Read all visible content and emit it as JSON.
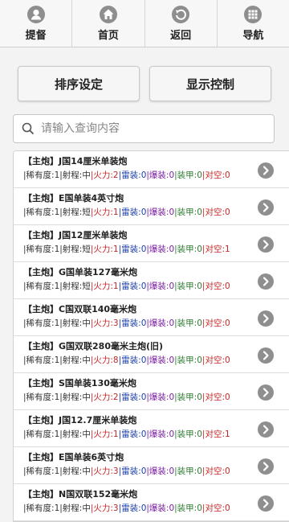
{
  "nav": [
    {
      "label": "提督",
      "icon": "user-icon"
    },
    {
      "label": "首页",
      "icon": "home-icon"
    },
    {
      "label": "返回",
      "icon": "back-icon"
    },
    {
      "label": "导航",
      "icon": "grid-icon"
    }
  ],
  "buttons": {
    "sort": "排序设定",
    "display": "显示控制"
  },
  "search": {
    "placeholder": "请输入查询内容",
    "value": ""
  },
  "stat_labels": {
    "rarity": "|稀有度:",
    "range": "|射程:",
    "firepower": "|火力:",
    "torpedo": "|雷装:",
    "bomb": "|爆装:",
    "armor": "|装甲:",
    "aa": "|对空:"
  },
  "items": [
    {
      "title": "【主炮】J国14厘米单装炮",
      "rarity": "1",
      "range": "中",
      "firepower": "2",
      "torpedo": "0",
      "bomb": "0",
      "armor": "0",
      "aa": "0"
    },
    {
      "title": "【主炮】E国单装4英寸炮",
      "rarity": "1",
      "range": "短",
      "firepower": "1",
      "torpedo": "0",
      "bomb": "0",
      "armor": "0",
      "aa": "0"
    },
    {
      "title": "【主炮】J国12厘米单装炮",
      "rarity": "1",
      "range": "短",
      "firepower": "1",
      "torpedo": "0",
      "bomb": "0",
      "armor": "0",
      "aa": "1"
    },
    {
      "title": "【主炮】G国单装127毫米炮",
      "rarity": "1",
      "range": "短",
      "firepower": "1",
      "torpedo": "0",
      "bomb": "0",
      "armor": "0",
      "aa": "0"
    },
    {
      "title": "【主炮】C国双联140毫米炮",
      "rarity": "1",
      "range": "中",
      "firepower": "3",
      "torpedo": "0",
      "bomb": "0",
      "armor": "0",
      "aa": "0"
    },
    {
      "title": "【主炮】G国双联280毫米主炮(旧)",
      "rarity": "1",
      "range": "中",
      "firepower": "8",
      "torpedo": "0",
      "bomb": "0",
      "armor": "0",
      "aa": "0"
    },
    {
      "title": "【主炮】S国单装130毫米炮",
      "rarity": "1",
      "range": "中",
      "firepower": "2",
      "torpedo": "0",
      "bomb": "0",
      "armor": "0",
      "aa": "0"
    },
    {
      "title": "【主炮】J国12.7厘米单装炮",
      "rarity": "1",
      "range": "中",
      "firepower": "1",
      "torpedo": "0",
      "bomb": "0",
      "armor": "0",
      "aa": "1"
    },
    {
      "title": "【主炮】E国单装6英寸炮",
      "rarity": "1",
      "range": "中",
      "firepower": "3",
      "torpedo": "0",
      "bomb": "0",
      "armor": "0",
      "aa": "0"
    },
    {
      "title": "【主炮】N国双联152毫米炮",
      "rarity": "1",
      "range": "中",
      "firepower": "3",
      "torpedo": "0",
      "bomb": "0",
      "armor": "0",
      "aa": "0"
    }
  ],
  "colors": {
    "firepower": "#c62828",
    "torpedo": "#1b3fa8",
    "bomb": "#7b1fa2",
    "armor": "#2e7d32",
    "aa": "#c62828",
    "icon_gray": "#8e8e8e"
  }
}
